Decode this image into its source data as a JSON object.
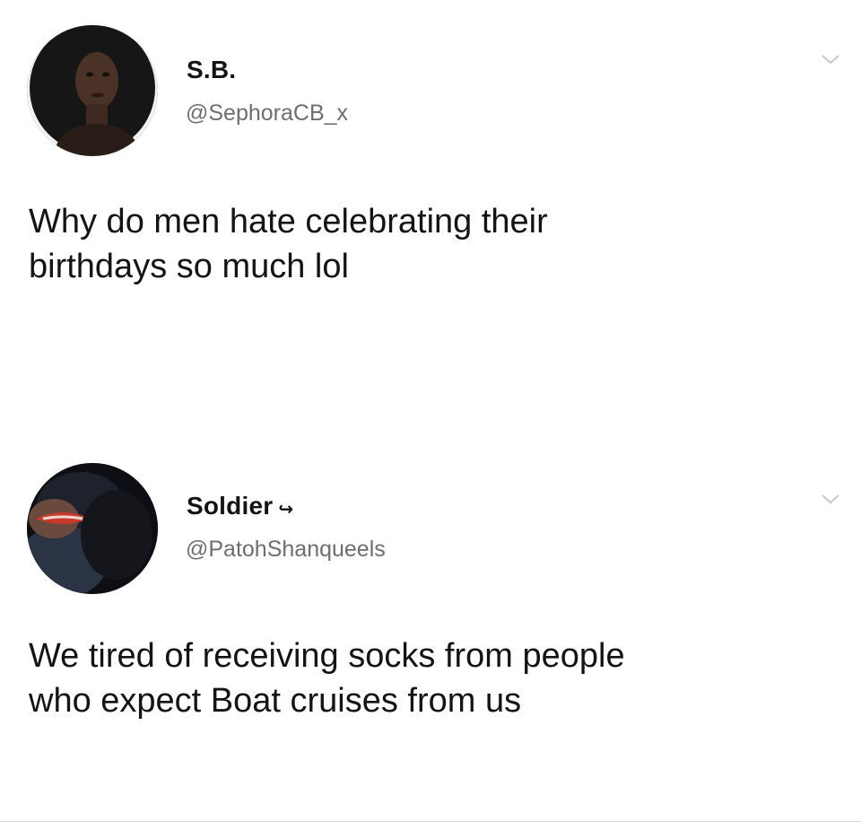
{
  "tweets": [
    {
      "display_name": "S.B.",
      "handle": "@SephoraCB_x",
      "text": "Why do men hate celebrating their\nbirthdays so much lol",
      "menu_icon": "chevron-down-icon",
      "avatar_icon": "profile-photo"
    },
    {
      "display_name": "Soldier",
      "name_suffix": "↪",
      "handle": "@PatohShanqueels",
      "text": "We tired of receiving socks from people\nwho expect Boat cruises from us",
      "menu_icon": "chevron-down-icon",
      "avatar_icon": "profile-photo"
    }
  ],
  "colors": {
    "background": "#ffffff",
    "text": "#141414",
    "handle": "#6e6e6e",
    "chevron": "#c8c8c8",
    "divider": "#d6d6d6"
  }
}
